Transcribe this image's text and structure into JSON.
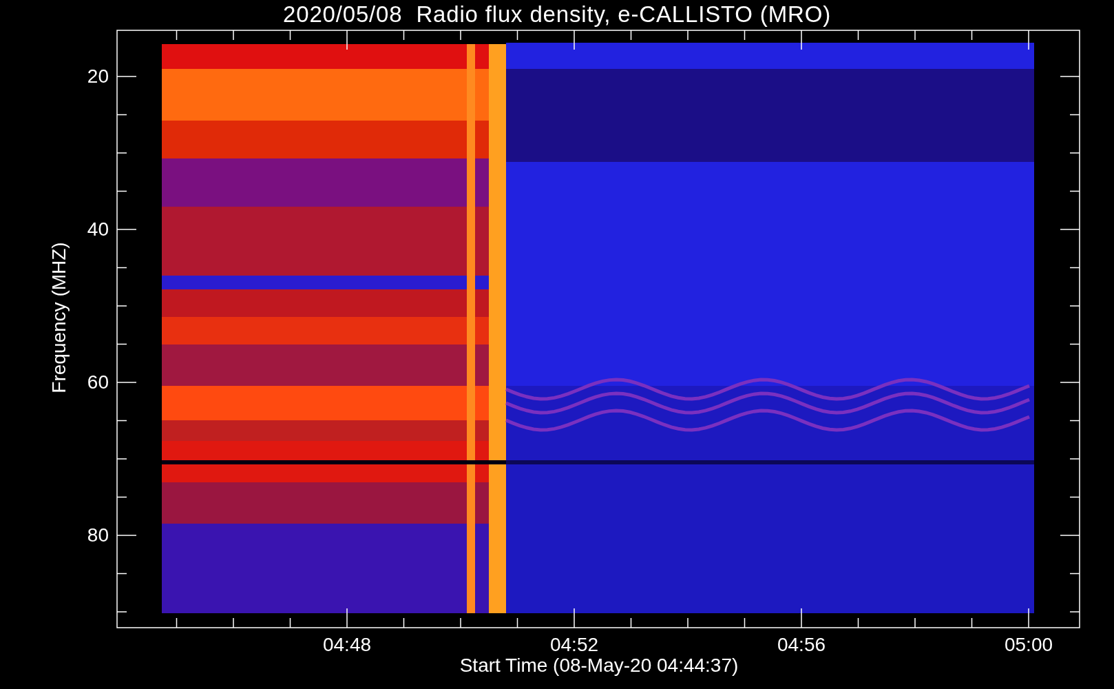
{
  "title": "2020/05/08  Radio flux density, e-CALLISTO (MRO)",
  "y_axis": {
    "label": "Frequency (MHZ)",
    "ticks": [
      "20",
      "40",
      "60",
      "80"
    ]
  },
  "x_axis": {
    "label": "Start Time (08-May-20 04:44:37)",
    "ticks": [
      "04:48",
      "04:52",
      "04:56",
      "05:00"
    ]
  }
}
